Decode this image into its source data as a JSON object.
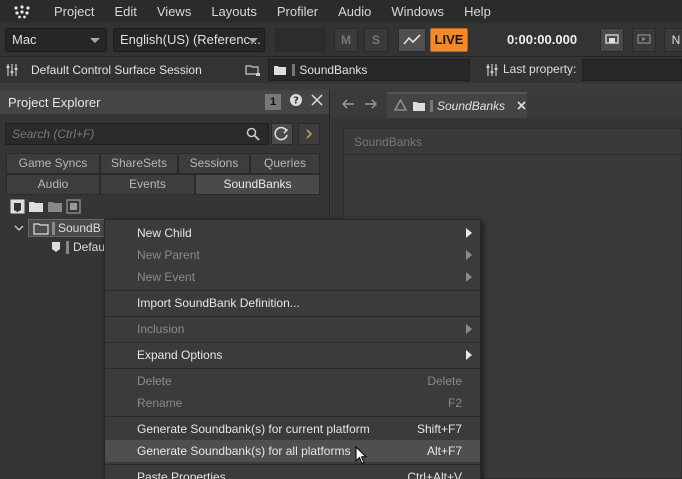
{
  "menubar": {
    "items": [
      "Project",
      "Edit",
      "Views",
      "Layouts",
      "Profiler",
      "Audio",
      "Windows",
      "Help"
    ]
  },
  "toolbar": {
    "platform": "Mac",
    "language": "English(US) (Referenc...",
    "btn_m": "M",
    "btn_s": "S",
    "live": "LIVE",
    "timecode": "0:00:00.000",
    "right_letter": "N"
  },
  "row2": {
    "session": "Default Control Surface Session",
    "path": "SoundBanks",
    "last_property_label": "Last property:"
  },
  "project_explorer": {
    "title": "Project Explorer",
    "badge": "1",
    "search_placeholder": "Search (Ctrl+F)",
    "tabs_row1": [
      "Game Syncs",
      "ShareSets",
      "Sessions",
      "Queries"
    ],
    "tabs_row2": [
      "Audio",
      "Events",
      "SoundBanks"
    ],
    "tree": [
      {
        "label": "SoundB"
      },
      {
        "label": "Defau"
      }
    ]
  },
  "editor": {
    "tab_title": "SoundBanks",
    "header": "SoundBanks"
  },
  "context_menu": {
    "items": [
      {
        "label": "New Child",
        "shortcut": "",
        "submenu": true,
        "disabled": false
      },
      {
        "label": "New Parent",
        "shortcut": "",
        "submenu": true,
        "disabled": true
      },
      {
        "label": "New Event",
        "shortcut": "",
        "submenu": true,
        "disabled": true
      },
      {
        "label": "Import SoundBank Definition...",
        "shortcut": "",
        "submenu": false,
        "disabled": false
      },
      {
        "label": "Inclusion",
        "shortcut": "",
        "submenu": true,
        "disabled": true
      },
      {
        "label": "Expand Options",
        "shortcut": "",
        "submenu": true,
        "disabled": false
      },
      {
        "label": "Delete",
        "shortcut": "Delete",
        "submenu": false,
        "disabled": true
      },
      {
        "label": "Rename",
        "shortcut": "F2",
        "submenu": false,
        "disabled": true
      },
      {
        "label": "Generate Soundbank(s) for current platform",
        "shortcut": "Shift+F7",
        "submenu": false,
        "disabled": false
      },
      {
        "label": "Generate Soundbank(s) for all platforms",
        "shortcut": "Alt+F7",
        "submenu": false,
        "disabled": false
      },
      {
        "label": "Paste Properties...",
        "shortcut": "Ctrl+Alt+V",
        "submenu": false,
        "disabled": false
      }
    ]
  },
  "colors": {
    "live_accent": "#f28a2b",
    "menu_bg": "#3b3b3b",
    "hover_bg": "#4f4f4f"
  }
}
